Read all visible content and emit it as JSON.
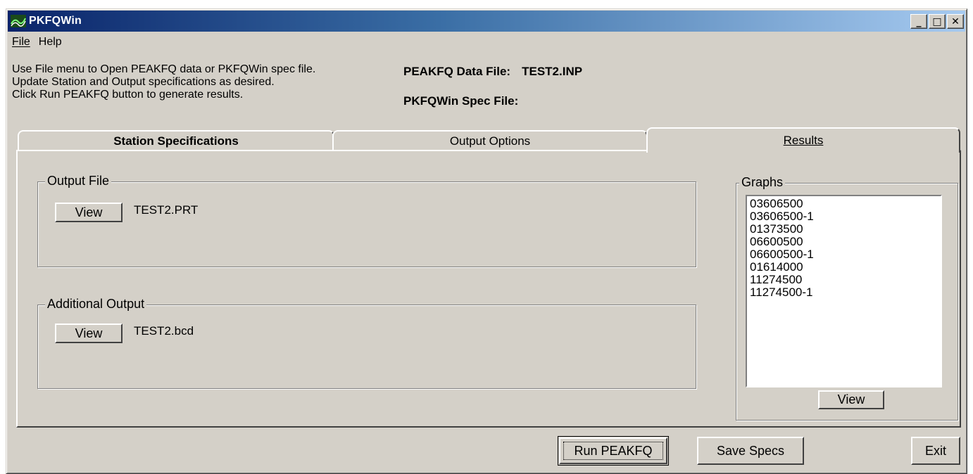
{
  "window": {
    "title": "PKFQWin",
    "minimize": "_",
    "maximize": "□",
    "close": "✕"
  },
  "menu": {
    "file": "File",
    "help": "Help"
  },
  "instructions": {
    "line1": "Use File menu to Open PEAKFQ data or PKFQWin spec file.",
    "line2": "Update Station and Output specifications as desired.",
    "line3": "Click Run PEAKFQ button to generate results."
  },
  "files": {
    "data_label": "PEAKFQ Data File:",
    "data_value": "TEST2.INP",
    "spec_label": "PKFQWin Spec File:",
    "spec_value": ""
  },
  "tabs": [
    {
      "label": "Station Specifications"
    },
    {
      "label": "Output Options"
    },
    {
      "label": "Results"
    }
  ],
  "output_file": {
    "title": "Output File",
    "view_label": "View",
    "file": "TEST2.PRT"
  },
  "additional_output": {
    "title": "Additional Output",
    "view_label": "View",
    "file": "TEST2.bcd"
  },
  "graphs": {
    "title": "Graphs",
    "items": [
      "03606500",
      "03606500-1",
      "01373500",
      "06600500",
      "06600500-1",
      "01614000",
      "11274500",
      "11274500-1"
    ],
    "view_label": "View"
  },
  "buttons": {
    "run": "Run PEAKFQ",
    "save": "Save Specs",
    "exit": "Exit"
  }
}
